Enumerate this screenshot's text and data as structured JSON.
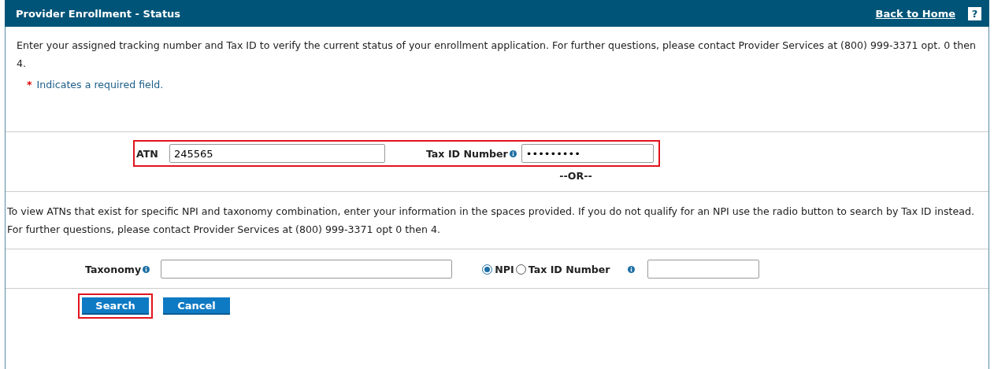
{
  "header": {
    "title": "Provider Enrollment - Status",
    "back_link": "Back to Home",
    "help": "?"
  },
  "intro": "Enter your assigned tracking number and Tax ID to verify the current status of your enrollment application. For further questions, please contact Provider Services at (800) 999-3371 opt. 0 then 4.",
  "required_note": {
    "mark": "*",
    "text": "Indicates a required field."
  },
  "atn_form": {
    "highlighted": true,
    "atn": {
      "label": "ATN",
      "value": "245565"
    },
    "tax_id": {
      "label": "Tax ID Number",
      "value": "•••••••••"
    },
    "separator": "--OR--"
  },
  "npi_intro": "To view ATNs that exist for specific NPI and taxonomy combination, enter your information in the spaces provided. If you do not qualify for an NPI use the radio button to search by Tax ID instead. For further questions, please contact Provider Services at (800) 999-3371 opt 0 then 4.",
  "npi_form": {
    "taxonomy": {
      "label": "Taxonomy"
    },
    "id_types": [
      {
        "label": "NPI",
        "selected": true
      },
      {
        "label": "Tax ID Number",
        "selected": false
      }
    ]
  },
  "buttons": [
    {
      "label": "Search",
      "highlighted": true
    },
    {
      "label": "Cancel",
      "highlighted": false
    }
  ]
}
